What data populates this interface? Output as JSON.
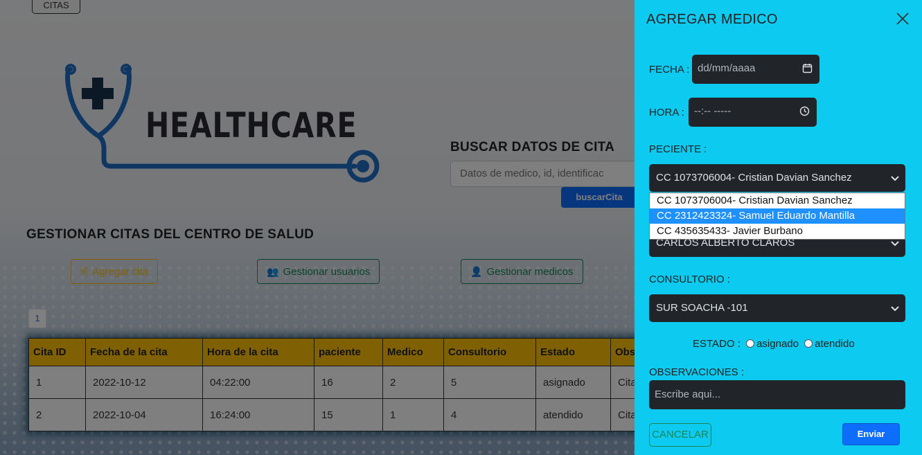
{
  "background": {
    "top_tab": "CITAS",
    "logo_text": "HEALTHCARE",
    "search": {
      "title": "BUSCAR DATOS DE CITA",
      "placeholder": "Datos de medico, id, identificac",
      "button": "buscarCita"
    },
    "manage_title": "GESTIONAR CITAS DEL CENTRO DE SALUD",
    "buttons": {
      "add_cita": "Agregar cita",
      "manage_users": "Gestionar usuarios",
      "manage_doctors": "Gestionar medicos"
    },
    "pagination": "1",
    "table": {
      "headers": [
        "Cita ID",
        "Fecha de la cita",
        "Hora de la cita",
        "paciente",
        "Medico",
        "Consultorio",
        "Estado",
        "Obs"
      ],
      "rows": [
        [
          "1",
          "2022-10-12",
          "04:22:00",
          "16",
          "2",
          "5",
          "asignado",
          "Cita"
        ],
        [
          "2",
          "2022-10-04",
          "16:24:00",
          "15",
          "1",
          "4",
          "atendido",
          "Cita"
        ]
      ]
    }
  },
  "panel": {
    "title": "AGREGAR MEDICO",
    "fecha_label": "FECHA :",
    "fecha_placeholder": "dd/mm/aaaa",
    "hora_label": "HORA :",
    "hora_placeholder": "--:--  -----",
    "paciente_label": "PECIENTE :",
    "paciente_selected": "CC 1073706004- Cristian Davian Sanchez",
    "paciente_options": [
      "CC 1073706004- Cristian Davian Sanchez",
      "CC 2312423324- Samuel Eduardo Mantilla",
      "CC 435635433- Javier Burbano"
    ],
    "paciente_highlighted_index": 1,
    "medico_selected": "CARLOS ALBERTO CLAROS",
    "consultorio_label": "CONSULTORIO :",
    "consultorio_selected": "SUR SOACHA -101",
    "estado_label": "ESTADO :",
    "estado_options": [
      "asignado",
      "atendido"
    ],
    "observaciones_label": "OBSERVACIONES :",
    "observaciones_placeholder": "Escribe aqui...",
    "cancel": "CANCELAR",
    "send": "Enviar"
  },
  "colors": {
    "panel_bg": "#0dcaf0",
    "field_bg": "#212529",
    "primary": "#0d6efd",
    "warning": "#ffc107",
    "success": "#198754"
  }
}
